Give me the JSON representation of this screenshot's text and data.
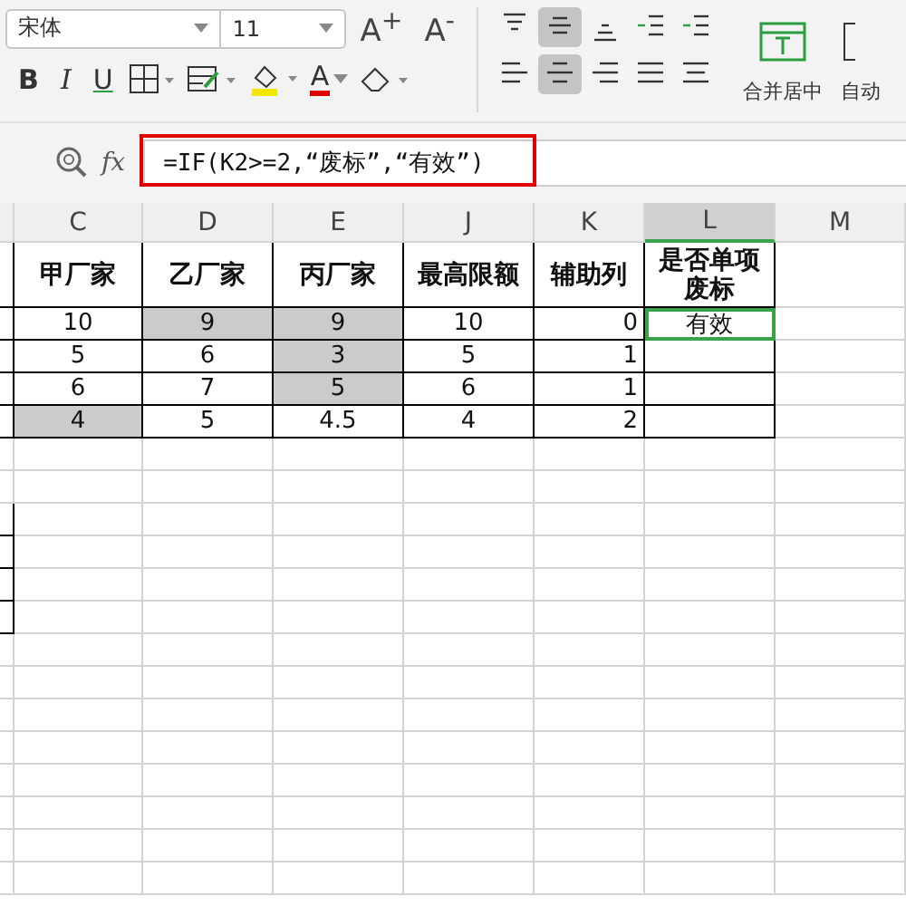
{
  "toolbar": {
    "font_name": "宋体",
    "font_size": "11",
    "grow_font": "A$^{+}$",
    "shrink_font": "A$^{-}$",
    "bold": "B",
    "italic": "I",
    "underline": "U",
    "font_color_letter": "A",
    "align_buttons": [
      {
        "kind": "top",
        "selected": false
      },
      {
        "kind": "middle",
        "selected": true
      },
      {
        "kind": "bottom",
        "selected": false
      },
      {
        "kind": "indent-decrease",
        "selected": false
      },
      {
        "kind": "indent-increase",
        "selected": false
      },
      {
        "kind": "left",
        "selected": false
      },
      {
        "kind": "center",
        "selected": true
      },
      {
        "kind": "right",
        "selected": false
      },
      {
        "kind": "justify",
        "selected": false
      },
      {
        "kind": "distribute",
        "selected": false
      }
    ],
    "merge_label": "合并居中",
    "autowrap_label": "自动"
  },
  "formula_bar": {
    "fx": "fx",
    "formula": "=IF(K2>=2,“废标”,“有效”)"
  },
  "columns": [
    {
      "selected": false
    },
    {
      "label": "C",
      "selected": false
    },
    {
      "label": "D",
      "selected": false
    },
    {
      "label": "E",
      "selected": false
    },
    {
      "label": "J",
      "selected": false
    },
    {
      "label": "K",
      "selected": false
    },
    {
      "label": "L",
      "selected": true
    },
    {
      "label": "M",
      "selected": false
    }
  ],
  "headers": [
    "甲厂家",
    "乙厂家",
    "丙厂家",
    "最高限额",
    "辅助列",
    "是否单项废标"
  ],
  "rows": [
    {
      "cells": [
        {
          "text": "10",
          "shaded": false,
          "selected": false
        },
        {
          "text": "9",
          "shaded": true,
          "selected": false
        },
        {
          "text": "9",
          "shaded": true,
          "selected": false
        },
        {
          "text": "10",
          "shaded": false,
          "selected": false
        },
        {
          "text": "0",
          "shaded": false,
          "selected": false
        },
        {
          "text": "有效",
          "shaded": false,
          "selected": true
        }
      ]
    },
    {
      "cells": [
        {
          "text": "5",
          "shaded": false,
          "selected": false
        },
        {
          "text": "6",
          "shaded": false,
          "selected": false
        },
        {
          "text": "3",
          "shaded": true,
          "selected": false
        },
        {
          "text": "5",
          "shaded": false,
          "selected": false
        },
        {
          "text": "1",
          "shaded": false,
          "selected": false
        },
        {
          "text": "",
          "shaded": false,
          "selected": false
        }
      ]
    },
    {
      "cells": [
        {
          "text": "6",
          "shaded": false,
          "selected": false
        },
        {
          "text": "7",
          "shaded": false,
          "selected": false
        },
        {
          "text": "5",
          "shaded": true,
          "selected": false
        },
        {
          "text": "6",
          "shaded": false,
          "selected": false
        },
        {
          "text": "1",
          "shaded": false,
          "selected": false
        },
        {
          "text": "",
          "shaded": false,
          "selected": false
        }
      ]
    },
    {
      "cells": [
        {
          "text": "4",
          "shaded": true,
          "selected": false
        },
        {
          "text": "5",
          "shaded": false,
          "selected": false
        },
        {
          "text": "4.5",
          "shaded": false,
          "selected": false
        },
        {
          "text": "4",
          "shaded": false,
          "selected": false
        },
        {
          "text": "2",
          "shaded": false,
          "selected": false
        },
        {
          "text": "",
          "shaded": false,
          "selected": false
        }
      ]
    }
  ]
}
